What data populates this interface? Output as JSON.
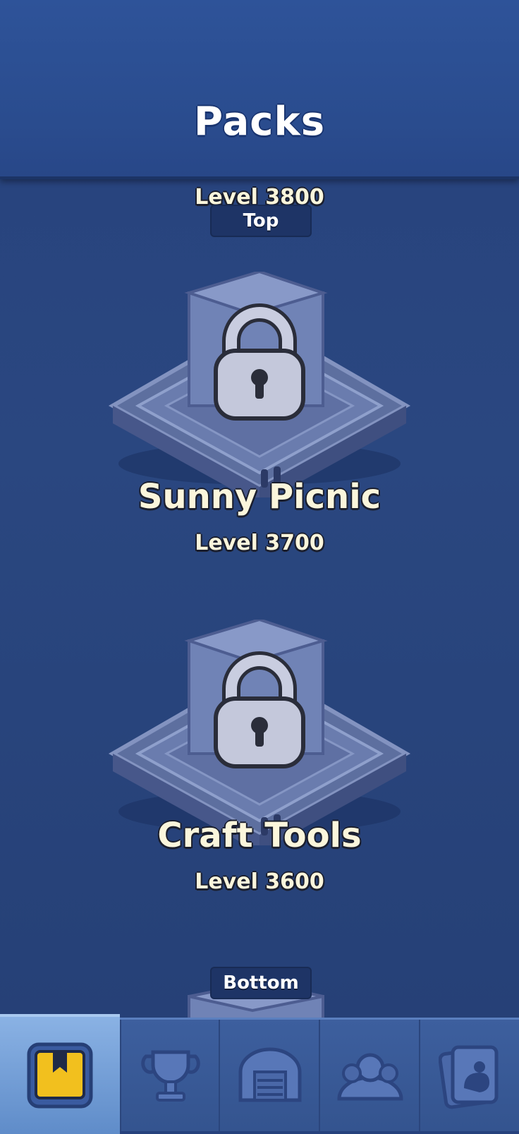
{
  "header": {
    "title": "Packs"
  },
  "top_partial": {
    "level": "Level 3800",
    "nav_label": "Top"
  },
  "packs": [
    {
      "name": "Sunny Picnic",
      "level": "Level 3700",
      "locked": true
    },
    {
      "name": "Craft Tools",
      "level": "Level 3600",
      "locked": true
    }
  ],
  "bottom_nav": {
    "label": "Bottom"
  },
  "tabs": [
    {
      "icon": "bookmark-icon",
      "active": true
    },
    {
      "icon": "trophy-icon",
      "active": false
    },
    {
      "icon": "arena-icon",
      "active": false
    },
    {
      "icon": "team-icon",
      "active": false
    },
    {
      "icon": "collection-icon",
      "active": false
    }
  ],
  "colors": {
    "background": "#27427d",
    "header": "#2e5399",
    "text_cream": "#fbf6dc",
    "active_tab": "#8ab2e4",
    "bookmark_yellow": "#f2c01e"
  }
}
